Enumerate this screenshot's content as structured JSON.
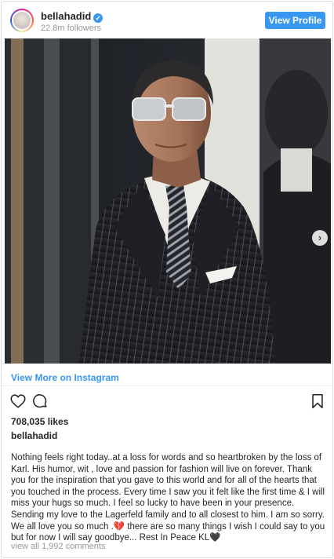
{
  "header": {
    "username": "bellahadid",
    "followers": "22.8m followers",
    "view_profile_label": "View Profile"
  },
  "post": {
    "view_more_label": "View More on Instagram",
    "likes": "708,035 likes",
    "owner": "bellahadid",
    "caption": "Nothing feels right today..at a loss for words and so heartbroken by the loss of Karl. His humor, wit , love and passion for fashion will live on forever. Thank you for the inspiration that you gave to this world and for all of the hearts that you touched in the process. Every time I saw you it felt like the first time & I will miss your hugs so much. I feel so lucky to have been in your presence. Sending my love to the Lagerfeld family and to all closest to him. I am so sorry. We all love you so much .💔 there are so many things I wish I could say to you but for now I will say goodbye... Rest In Peace KL🖤",
    "comments_link": "view all 1,992 comments"
  },
  "icons": {
    "verified": "verified-badge-icon",
    "like": "heart-icon",
    "comment": "comment-bubble-icon",
    "save": "bookmark-icon",
    "carousel_next": "chevron-right-icon"
  },
  "colors": {
    "accent": "#3897f0",
    "text": "#262626",
    "muted": "#999999"
  }
}
